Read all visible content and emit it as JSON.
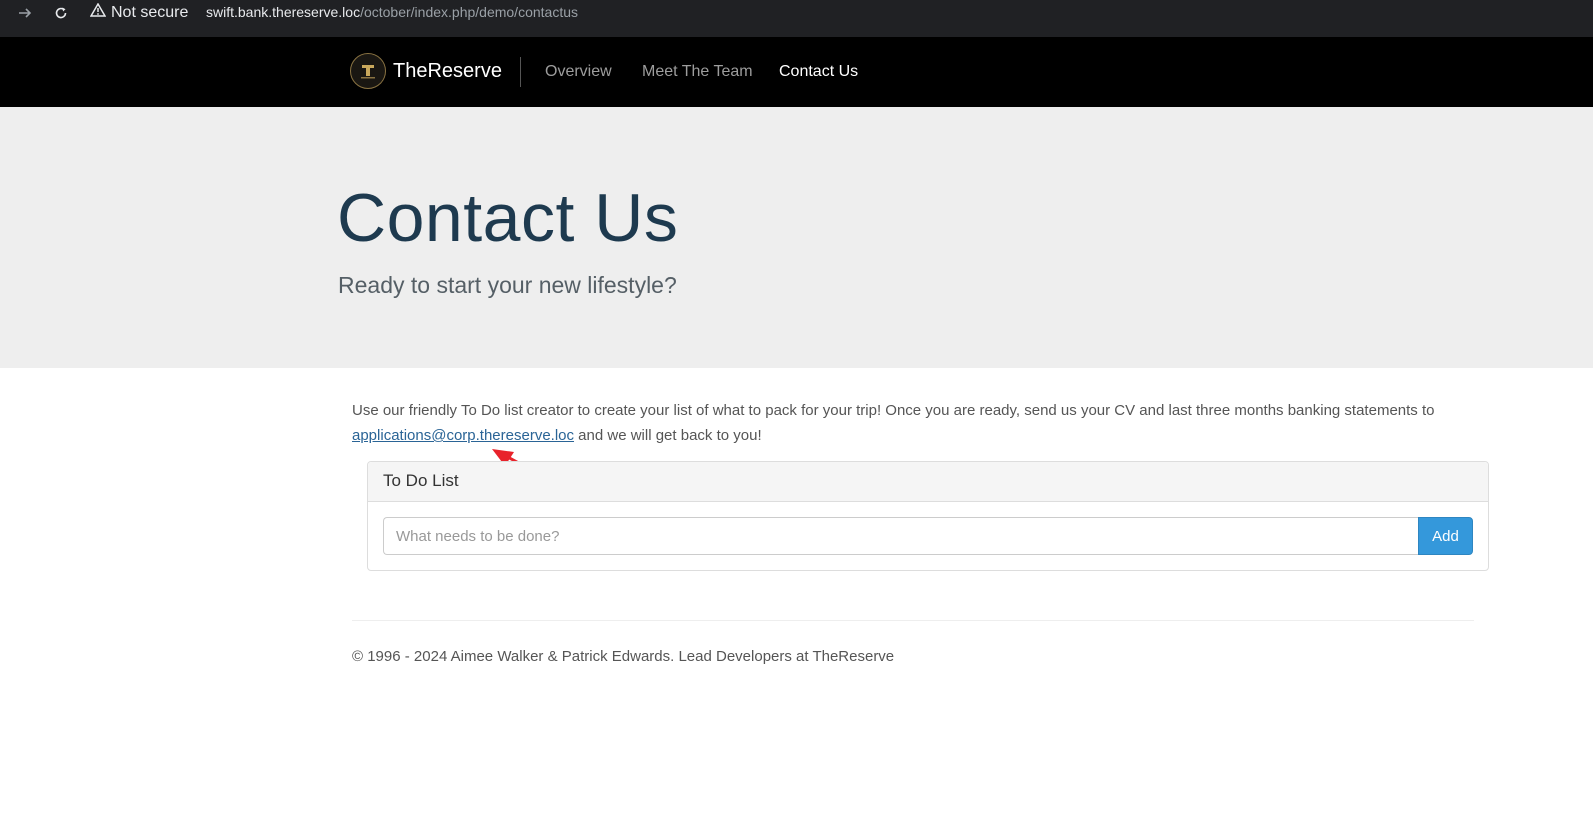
{
  "browser": {
    "security_label": "Not secure",
    "url_host": "swift.bank.thereserve.loc",
    "url_path": "/october/index.php/demo/contactus"
  },
  "navbar": {
    "brand": "TheReserve",
    "links": [
      {
        "label": "Overview",
        "active": false
      },
      {
        "label": "Meet The Team",
        "active": false
      },
      {
        "label": "Contact Us",
        "active": true
      }
    ]
  },
  "hero": {
    "title": "Contact Us",
    "subtitle": "Ready to start your new lifestyle?"
  },
  "intro": {
    "text_before": "Use our friendly To Do list creator to create your list of what to pack for your trip! Once you are ready, send us your CV and last three months banking statements to ",
    "email": "applications@corp.thereserve.loc",
    "text_after": " and we will get back to you!"
  },
  "todo": {
    "heading": "To Do List",
    "placeholder": "What needs to be done?",
    "value": "",
    "add_label": "Add"
  },
  "footer": {
    "text": "© 1996 - 2024 Aimee Walker & Patrick Edwards. Lead Developers at TheReserve"
  },
  "colors": {
    "title": "#1e3a4f",
    "link": "#2a6496",
    "add_button": "#3498db",
    "annotation_arrow": "#e8232b"
  },
  "icons": [
    "forward-arrow-icon",
    "reload-icon",
    "warning-icon",
    "brand-logo"
  ]
}
